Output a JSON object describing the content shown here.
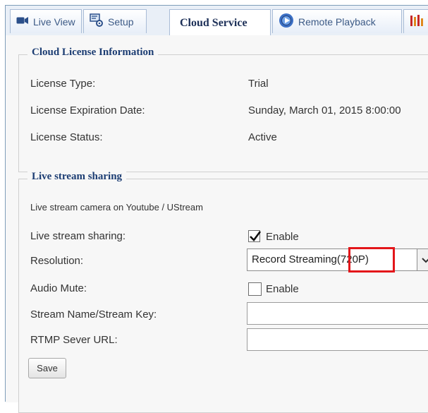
{
  "tabs": [
    {
      "label": "Live View",
      "icon": "live-view-icon"
    },
    {
      "label": "Setup",
      "icon": "setup-icon"
    },
    {
      "label": "Cloud Service",
      "icon": "",
      "active": true
    },
    {
      "label": "Remote Playback",
      "icon": "remote-playback-icon"
    },
    {
      "label": "",
      "icon": "bars-icon"
    }
  ],
  "license": {
    "title": "Cloud License Information",
    "type_label": "License Type:",
    "type_value": "Trial",
    "expiration_label": "License Expiration Date:",
    "expiration_value": "Sunday, March 01, 2015 8:00:00",
    "status_label": "License Status:",
    "status_value": "Active"
  },
  "livestream": {
    "title": "Live stream sharing",
    "description": "Live stream camera on Youtube / UStream",
    "sharing_label": "Live stream sharing:",
    "sharing_checkbox_label": "Enable",
    "sharing_checked": true,
    "resolution_label": "Resolution:",
    "resolution_value": "Record Streaming(720P)",
    "audio_label": "Audio Mute:",
    "audio_checkbox_label": "Enable",
    "audio_checked": false,
    "stream_name_label": "Stream Name/Stream Key:",
    "stream_name_value": "",
    "rtmp_label": "RTMP Sever URL:",
    "rtmp_value": "",
    "save_label": "Save"
  },
  "colors": {
    "highlight": "#e3161a",
    "legend_text": "#1c3d73",
    "tab_text": "#3c5a86"
  }
}
